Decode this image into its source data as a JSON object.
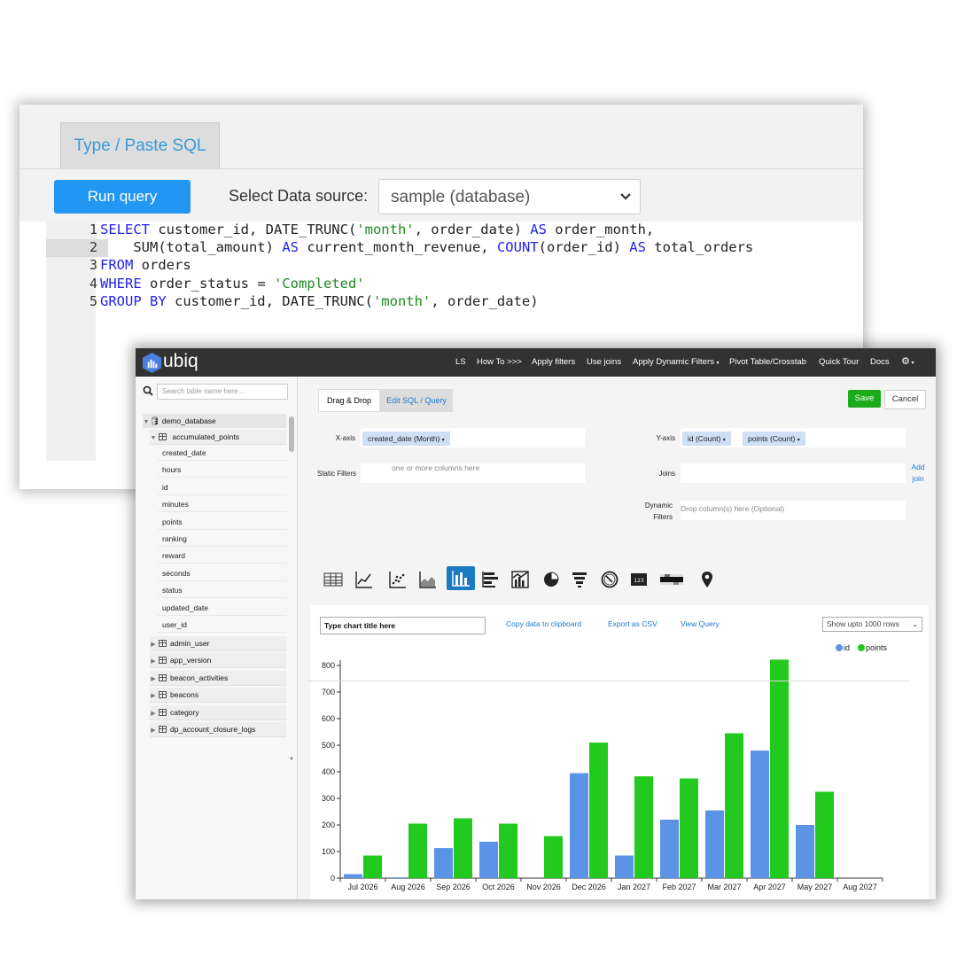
{
  "sql_editor": {
    "tab_label": "Type / Paste SQL",
    "run_button": "Run query",
    "datasource_label": "Select Data source:",
    "datasource_value": "sample (database)",
    "line_numbers": [
      "1",
      "2",
      "3",
      "4",
      "5"
    ],
    "lines": [
      [
        {
          "t": "SELECT",
          "k": "kw"
        },
        {
          "t": " customer_id, DATE_TRUNC(",
          "k": ""
        },
        {
          "t": "'month'",
          "k": "str"
        },
        {
          "t": ", order_date) ",
          "k": ""
        },
        {
          "t": "AS",
          "k": "kw"
        },
        {
          "t": " order_month,",
          "k": ""
        }
      ],
      [
        {
          "t": "    SUM(total_amount) ",
          "k": ""
        },
        {
          "t": "AS",
          "k": "kw"
        },
        {
          "t": " current_month_revenue, ",
          "k": ""
        },
        {
          "t": "COUNT",
          "k": "kw"
        },
        {
          "t": "(order_id) ",
          "k": ""
        },
        {
          "t": "AS",
          "k": "kw"
        },
        {
          "t": " total_orders",
          "k": ""
        }
      ],
      [
        {
          "t": "FROM",
          "k": "kw"
        },
        {
          "t": " orders",
          "k": ""
        }
      ],
      [
        {
          "t": "WHERE",
          "k": "kw"
        },
        {
          "t": " order_status = ",
          "k": ""
        },
        {
          "t": "'Completed'",
          "k": "str"
        }
      ],
      [
        {
          "t": "GROUP BY",
          "k": "kw"
        },
        {
          "t": " customer_id, DATE_TRUNC(",
          "k": ""
        },
        {
          "t": "'month'",
          "k": "str"
        },
        {
          "t": ", order_date)",
          "k": ""
        }
      ]
    ]
  },
  "ubiq": {
    "brand": "ubiq",
    "nav": [
      "LS",
      "How To >>>",
      "Apply filters",
      "Use joins",
      "Apply Dynamic Filters",
      "Pivot Table/Crosstab",
      "Quick Tour",
      "Docs"
    ],
    "search_placeholder": "Search table name here...",
    "database": "demo_database",
    "open_table": "accumulated_points",
    "columns": [
      "created_date",
      "hours",
      "id",
      "minutes",
      "points",
      "ranking",
      "reward",
      "seconds",
      "status",
      "updated_date",
      "user_id"
    ],
    "tables": [
      "admin_user",
      "app_version",
      "beacon_activities",
      "beacons",
      "category",
      "dp_account_closure_logs"
    ],
    "tabs": [
      "Drag & Drop",
      "Edit SQL / Query"
    ],
    "save": "Save",
    "cancel": "Cancel",
    "xaxis_label": "X-axis",
    "xaxis_pill": "created_date (Month)",
    "yaxis_label": "Y-axis",
    "yaxis_pills": [
      "id (Count)",
      "points (Count)"
    ],
    "static_filters_label": "Static Filters",
    "static_filters_placeholder": "one or more columns here",
    "joins_label": "Joins",
    "add_join": "Add join",
    "dynamic_label_1": "Dynamic",
    "dynamic_label_2": "Filters",
    "dynamic_placeholder": "Drop column(s) here (Optional)",
    "chart_icons": [
      "table-icon",
      "line-chart-icon",
      "scatter-chart-icon",
      "area-chart-icon",
      "bar-chart-icon",
      "horizontal-bar-icon",
      "combo-chart-icon",
      "pie-chart-icon",
      "funnel-icon",
      "gauge-icon",
      "number-icon",
      "heatmap-icon",
      "map-pin-icon"
    ],
    "selected_chart_icon": "bar-chart-icon",
    "chart_title_value": "Type chart title here",
    "copy_link": "Copy data to clipboard",
    "export_link": "Export as CSV",
    "view_query_link": "View Query",
    "rows_select": "Show upto 1000 rows",
    "colors": {
      "id": "#5b93e6",
      "points": "#22c91e"
    }
  },
  "chart_data": {
    "type": "bar",
    "categories": [
      "Jul 2026",
      "Aug 2026",
      "Sep 2026",
      "Oct 2026",
      "Nov 2026",
      "Dec 2026",
      "Jan 2027",
      "Feb 2027",
      "Mar 2027",
      "Apr 2027",
      "May 2027",
      "Aug 2027"
    ],
    "series": [
      {
        "name": "id",
        "values": [
          15,
          3,
          113,
          137,
          0,
          395,
          85,
          220,
          255,
          480,
          200,
          0
        ]
      },
      {
        "name": "points",
        "values": [
          85,
          205,
          225,
          205,
          158,
          510,
          383,
          375,
          545,
          822,
          325,
          0
        ]
      }
    ],
    "ylim": [
      0,
      800
    ],
    "yticks": [
      0,
      100,
      200,
      300,
      400,
      500,
      600,
      700,
      800
    ],
    "legend": "top-right",
    "grid": false
  }
}
